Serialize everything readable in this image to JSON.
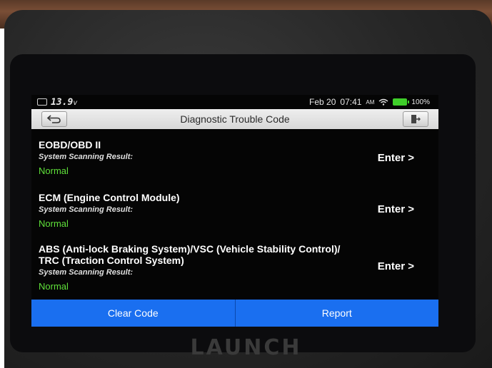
{
  "device": {
    "brand": "LAUNCH"
  },
  "status": {
    "voltage": "13.9",
    "voltage_unit": "v",
    "date": "Feb 20",
    "time": "07:41",
    "ampm": "AM",
    "battery_pct": "100%",
    "battery_color": "#3fcf2a"
  },
  "header": {
    "title": "Diagnostic Trouble Code",
    "back_icon": "back-arrow-icon",
    "exit_icon": "exit-icon"
  },
  "systems": [
    {
      "name": "EOBD/OBD II",
      "sub": "System Scanning Result:",
      "status": "Normal",
      "action": "Enter >"
    },
    {
      "name": "ECM (Engine Control Module)",
      "sub": "System Scanning Result:",
      "status": "Normal",
      "action": "Enter >"
    },
    {
      "name_line1": "ABS (Anti-lock Braking System)/VSC (Vehicle Stability Control)/",
      "name_line2": "TRC (Traction Control System)",
      "sub": "System Scanning Result:",
      "status": "Normal",
      "action": "Enter >"
    }
  ],
  "footer": {
    "clear_label": "Clear Code",
    "report_label": "Report",
    "accent": "#1a6ff0"
  }
}
